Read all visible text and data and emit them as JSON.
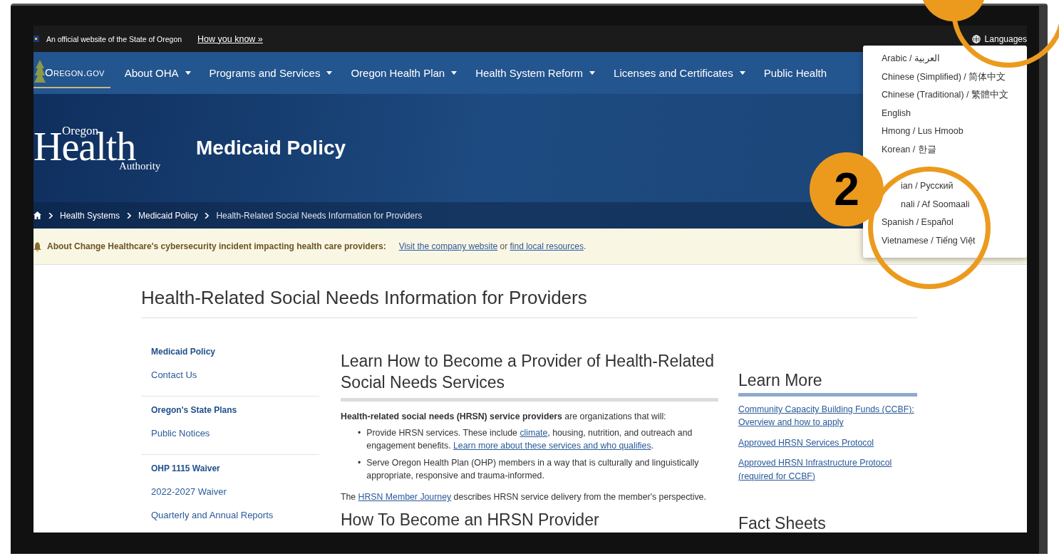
{
  "official_banner": {
    "text": "An official website of the State of Oregon",
    "link": "How you know »"
  },
  "languages_button": {
    "label": "Languages"
  },
  "nav": {
    "logo": "Oregon.gov",
    "items": [
      {
        "label": "About OHA",
        "has_menu": true
      },
      {
        "label": "Programs and Services",
        "has_menu": true
      },
      {
        "label": "Oregon Health Plan",
        "has_menu": true
      },
      {
        "label": "Health System Reform",
        "has_menu": true
      },
      {
        "label": "Licenses and Certificates",
        "has_menu": true
      },
      {
        "label": "Public Health",
        "has_menu": false
      }
    ]
  },
  "hero": {
    "logo": {
      "top": "Oregon",
      "main": "Health",
      "bottom": "Authority"
    },
    "title": "Medicaid Policy"
  },
  "breadcrumb": [
    {
      "label": "Health Systems",
      "current": false
    },
    {
      "label": "Medicaid Policy",
      "current": false
    },
    {
      "label": "Health-Related Social Needs Information for Providers",
      "current": true
    }
  ],
  "alert": {
    "title": "About Change Healthcare's cybersecurity incident impacting health care providers:",
    "parts": [
      {
        "kind": "link",
        "text": "Visit the company website"
      },
      {
        "kind": "text",
        "text": " or "
      },
      {
        "kind": "link",
        "text": "find local resources"
      },
      {
        "kind": "text",
        "text": "."
      }
    ]
  },
  "page_title": "Health-Related Social Needs Information for Providers",
  "sidebar": [
    {
      "items": [
        {
          "kind": "heading",
          "label": "Medicaid Policy"
        },
        {
          "kind": "link",
          "label": "Contact Us"
        }
      ]
    },
    {
      "items": [
        {
          "kind": "heading",
          "label": "Oregon's State Plans"
        },
        {
          "kind": "link",
          "label": "Public Notices"
        }
      ]
    },
    {
      "items": [
        {
          "kind": "heading",
          "label": "OHP 1115 Waiver"
        },
        {
          "kind": "link",
          "label": "2022-2027 Waiver"
        },
        {
          "kind": "link",
          "label": "Quarterly and Annual Reports"
        }
      ]
    }
  ],
  "main": {
    "heading": "Learn How to Become a Provider of Health-Related Social Needs Services",
    "intro": "**Health-related social needs (HRSN) service providers** are organizations that will:",
    "bullets": [
      {
        "marker": "•",
        "parts": [
          {
            "kind": "text",
            "text": "Provide HRSN services. These include "
          },
          {
            "kind": "link",
            "text": "climate"
          },
          {
            "kind": "text",
            "text": ", housing, nutrition, and outreach and engagement benefits. "
          },
          {
            "kind": "link",
            "text": "Learn more about these services and who qualifies"
          },
          {
            "kind": "text",
            "text": "."
          }
        ]
      },
      {
        "marker": "•",
        "parts": [
          {
            "kind": "text",
            "text": "Serve Oregon Health Plan (OHP) members in a way that is culturally and linguistically appropriate, responsive and trauma-informed."
          }
        ]
      }
    ],
    "closing": [
      {
        "kind": "text",
        "text": "The "
      },
      {
        "kind": "link",
        "text": "HRSN Member Journey"
      },
      {
        "kind": "text",
        "text": " describes HRSN service delivery from the member's perspective."
      }
    ],
    "next_heading": "How To Become an HRSN Provider"
  },
  "aside": [
    {
      "heading": "Learn More",
      "links": [
        "Community Capacity Building Funds (CCBF): Overview and how to apply",
        "Approved HRSN Services Protocol",
        "Approved HRSN Infrastructure Protocol (required for CCBF)"
      ]
    },
    {
      "heading": "Fact Sheets"
    }
  ],
  "language_menu": [
    {
      "kind": "full",
      "label": "Arabic / العربية"
    },
    {
      "kind": "full",
      "label": "Chinese (Simplified) / 简体中文"
    },
    {
      "kind": "full",
      "label": "Chinese (Traditional) / 繁體中文"
    },
    {
      "kind": "full",
      "label": "English"
    },
    {
      "kind": "full",
      "label": "Hmong / Lus Hmoob"
    },
    {
      "kind": "full",
      "label": "Korean / 한글"
    },
    {
      "kind": "clipped",
      "label": "ian / Русский"
    },
    {
      "kind": "clipped",
      "label": "nali / Af Soomaali"
    },
    {
      "kind": "full",
      "label": "Spanish / Español"
    },
    {
      "kind": "full",
      "label": "Vietnamese / Tiếng Việt"
    }
  ],
  "annotations": [
    {
      "kind": "dot"
    },
    {
      "kind": "ring"
    },
    {
      "kind": "badge",
      "label": "2"
    },
    {
      "kind": "ring"
    }
  ]
}
